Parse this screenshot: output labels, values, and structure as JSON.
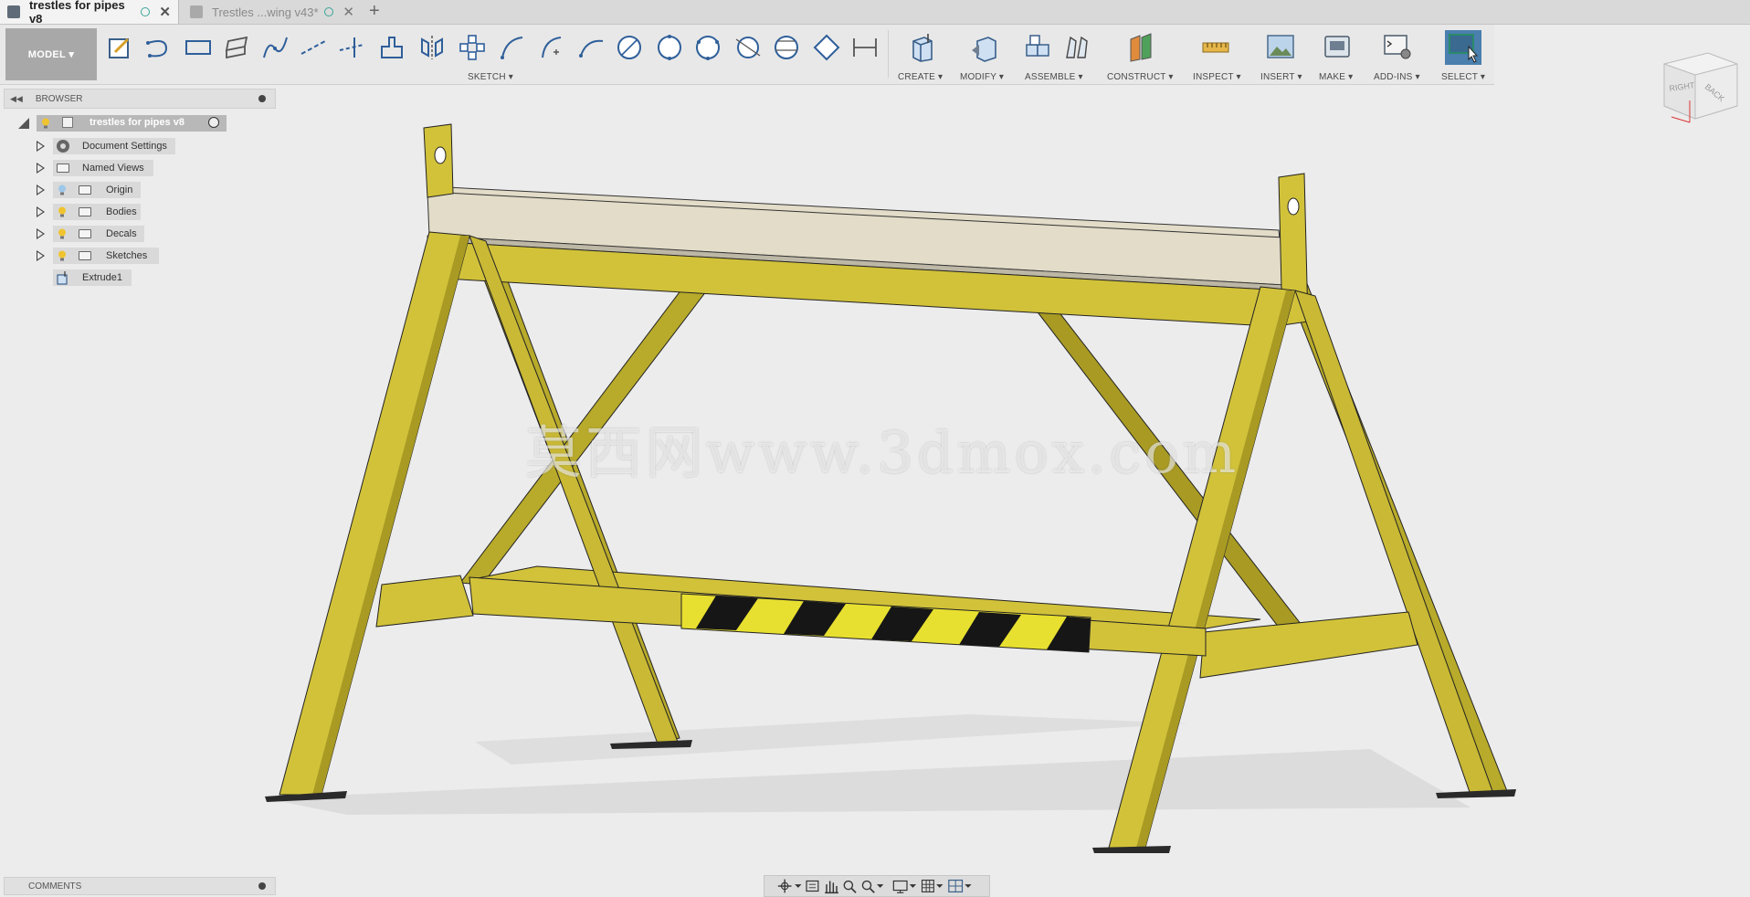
{
  "tabs": [
    {
      "label": "trestles for pipes v8",
      "active": true
    },
    {
      "label": "Trestles ...wing v43*",
      "active": false
    }
  ],
  "new_tab_symbol": "+",
  "toolbar": {
    "workspace_label": "MODEL",
    "groups": {
      "sketch": "SKETCH",
      "create": "CREATE",
      "modify": "MODIFY",
      "assemble": "ASSEMBLE",
      "construct": "CONSTRUCT",
      "inspect": "INSPECT",
      "insert": "INSERT",
      "make": "MAKE",
      "addins": "ADD-INS",
      "select": "SELECT"
    }
  },
  "browser": {
    "title": "BROWSER",
    "root": "trestles for pipes v8",
    "items": [
      {
        "label": "Document Settings"
      },
      {
        "label": "Named Views"
      },
      {
        "label": "Origin"
      },
      {
        "label": "Bodies"
      },
      {
        "label": "Decals"
      },
      {
        "label": "Sketches"
      },
      {
        "label": "Extrude1"
      }
    ]
  },
  "comments": {
    "title": "COMMENTS"
  },
  "viewcube": {
    "right": "RIGHT",
    "back": "BACK"
  },
  "watermark": "莫西网www.3dmox.com",
  "colors": {
    "trestle_yellow": "#d2c23a",
    "trestle_shadow": "#a89a23",
    "top_plate": "#e2dcc8",
    "stripe_black": "#161616",
    "stripe_yellow": "#e8e030",
    "select_blue": "#4a7fae"
  }
}
